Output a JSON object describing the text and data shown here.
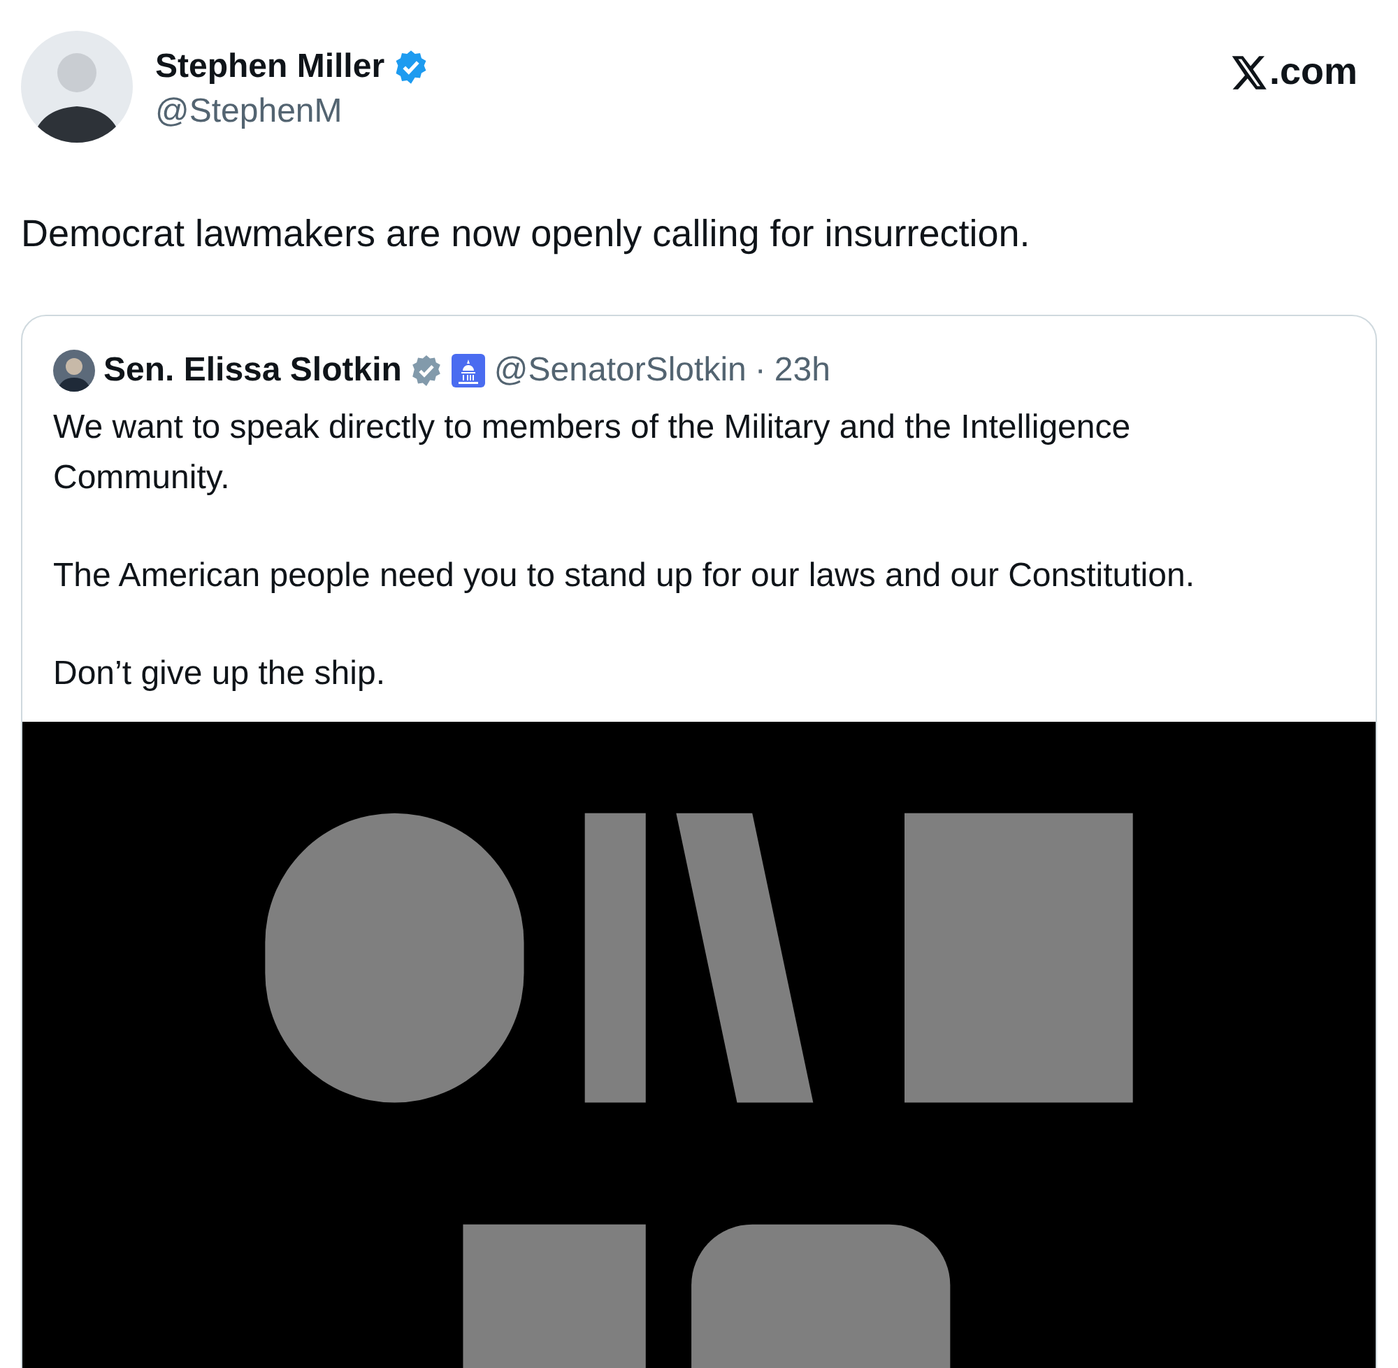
{
  "tweet": {
    "author": {
      "name": "Stephen Miller",
      "handle": "@StephenM",
      "verified": true,
      "badge": {
        "color": "#1d9bf0"
      }
    },
    "site": {
      "label": ".com"
    },
    "text": "Democrat lawmakers are now openly calling for insurrection.",
    "quote": {
      "author": {
        "name": "Sen. Elissa Slotkin",
        "handle": "@SenatorSlotkin",
        "verified": true,
        "badge": {
          "color": "#829aab"
        },
        "affiliate_badge": true
      },
      "separator": "·",
      "time": "23h",
      "paragraphs": [
        "We want to speak directly to members of the Military and the Intelligence Community.",
        "The American people need you to stand up for our laws and our Constitution.",
        "Don’t give up the ship."
      ]
    }
  }
}
